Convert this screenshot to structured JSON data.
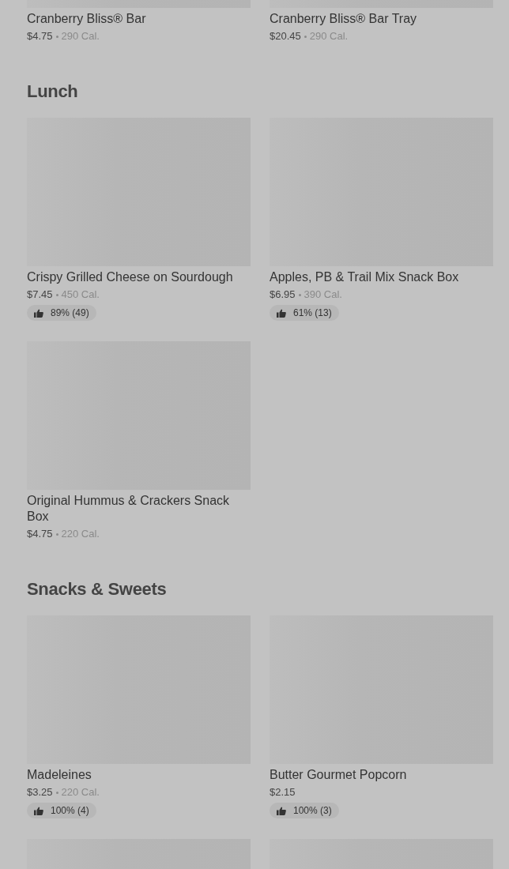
{
  "sections": [
    {
      "items": [
        {
          "kind": "item",
          "name": "Cranberry Bliss® Bar",
          "price": "$4.75",
          "calories": "290 Cal."
        },
        {
          "kind": "item",
          "name": "Cranberry Bliss® Bar Tray",
          "price": "$20.45",
          "calories": "290 Cal."
        }
      ]
    },
    {
      "heading": "Lunch",
      "items": [
        {
          "kind": "item",
          "name": "Crispy Grilled Cheese on Sourdough",
          "price": "$7.45",
          "calories": "450 Cal.",
          "rating": "89% (49)"
        },
        {
          "kind": "item",
          "name": "Apples, PB & Trail Mix Snack Box",
          "price": "$6.95",
          "calories": "390 Cal.",
          "rating": "61% (13)"
        },
        {
          "kind": "item",
          "name": "Original Hummus & Crackers Snack Box",
          "price": "$4.75",
          "calories": "220 Cal."
        }
      ]
    },
    {
      "heading": "Snacks & Sweets",
      "items": [
        {
          "kind": "item",
          "name": "Madeleines",
          "price": "$3.25",
          "calories": "220 Cal.",
          "rating": "100% (4)"
        },
        {
          "kind": "item",
          "name": "Butter Gourmet Popcorn",
          "price": "$2.15",
          "rating": "100% (3)"
        },
        {
          "kind": "image"
        },
        {
          "kind": "image"
        }
      ]
    }
  ]
}
